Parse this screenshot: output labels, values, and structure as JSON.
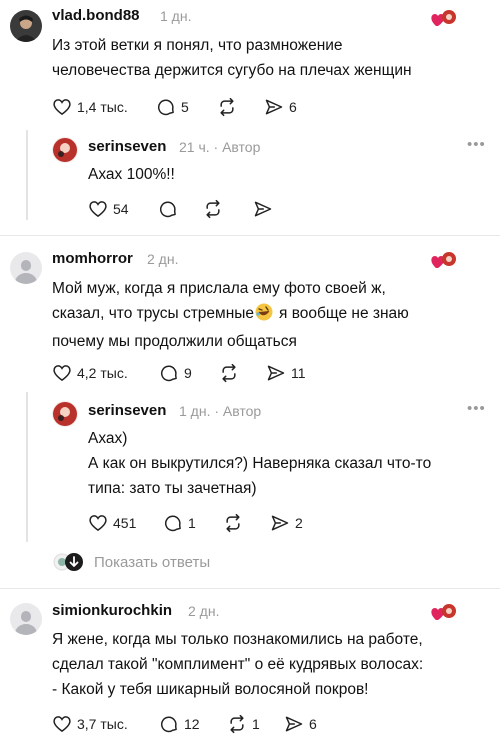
{
  "comments": [
    {
      "username": "vlad.bond88",
      "time": "1 дн.",
      "lines": [
        "Из этой ветки я понял, что размножение",
        "человечества держится сугубо на плечах женщин"
      ],
      "likes": "1,4 тыс.",
      "replies": "5",
      "reposts": "",
      "shares": "6",
      "reply": {
        "username": "serinseven",
        "meta": "21 ч. · Автор",
        "lines": [
          "Ахах 100%!!"
        ],
        "likes": "54",
        "replies": "",
        "reposts": "",
        "shares": ""
      }
    },
    {
      "username": "momhorror",
      "time": "2 дн.",
      "lines": [
        "Мой муж, когда я прислала ему фото своей ж,",
        "сказал, что трусы стремные",
        "я вообще не знаю",
        "почему мы продолжили общаться"
      ],
      "likes": "4,2 тыс.",
      "replies": "9",
      "reposts": "",
      "shares": "11",
      "reply": {
        "username": "serinseven",
        "meta": "1 дн. · Автор",
        "lines": [
          "Ахах)",
          "А как он выкрутился?) Наверняка сказал что-то",
          "типа: зато ты зачетная)"
        ],
        "likes": "451",
        "replies": "1",
        "reposts": "",
        "shares": "2"
      },
      "show_replies": "Показать ответы"
    },
    {
      "username": "simionkurochkin",
      "time": "2 дн.",
      "lines": [
        "Я жене, когда мы только познакомились на работе,",
        "сделал такой \"комплимент\" о её кудрявых волосах:",
        "- Какой у тебя шикарный волосяной покров!"
      ],
      "likes": "3,7 тыс.",
      "replies": "12",
      "reposts": "1",
      "shares": "6"
    }
  ],
  "icons": {
    "like": "heart-outline-icon",
    "reply": "speech-bubble-icon",
    "repost": "repost-arrows-icon",
    "share": "send-arrow-icon",
    "more": "more-dots-icon",
    "author_like": "author-liked-heart-icon",
    "emoji": "rolling-laughing-emoji",
    "expand": "expand-down-icon"
  },
  "colors": {
    "heart": "#e0245e",
    "muted": "#9a9a9a",
    "text": "#111111"
  }
}
